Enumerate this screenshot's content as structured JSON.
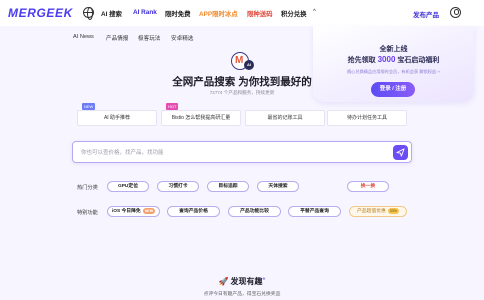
{
  "header": {
    "logo": "MERGEEK",
    "nav": [
      {
        "label": "AI 搜索",
        "color": "#222222"
      },
      {
        "label": "AI Rank",
        "color": "#3a2bd8"
      },
      {
        "label": "限时免费",
        "color": "#222222"
      },
      {
        "label": "APP限时冰点",
        "color": "#f08a2c"
      },
      {
        "label": "限种送码",
        "color": "#e0473a"
      },
      {
        "label": "积分兑换",
        "color": "#222222"
      }
    ],
    "more_icon": "chevron-up-icon",
    "publish_label": "发布产品"
  },
  "subnav": [
    "AI News",
    "产品情报",
    "极客玩法",
    "安卓精选"
  ],
  "promo": {
    "line1": "全新上线",
    "line2_prefix": "抢先领取 ",
    "line2_number": "3000",
    "line2_suffix": " 宝石启动福利",
    "line3": "随心兑换精品应用限时会员，有机会获 解锁权益 ››",
    "cta": "登录 / 注册"
  },
  "hero": {
    "mascot_letter": "M",
    "mascot_badge": "AI",
    "title": "全网产品搜索 为你找到最好的",
    "subtitle": "72774 个产品和服务，持续更新"
  },
  "top_chips": [
    {
      "label": "AI 助手推荐",
      "tag": "NEW",
      "tag_color": "#6b7cf5"
    },
    {
      "label": "Bistio 怎么帮我提高研汇量",
      "tag": "HOT",
      "tag_color": "#e64db3"
    },
    {
      "label": "最省的记账工具",
      "tag": "",
      "tag_color": ""
    },
    {
      "label": "待办计划任务工具",
      "tag": "",
      "tag_color": ""
    }
  ],
  "search": {
    "placeholder": "你也可以查价格，找产品，找功能"
  },
  "hot_categories": {
    "label": "热门分类",
    "items": [
      "GPU定位",
      "习惯打卡",
      "目标追踪",
      "天体搜索",
      "换一换"
    ]
  },
  "special_features": {
    "label": "特别功能",
    "items": [
      {
        "label": "iOS 今日降免",
        "badge": "NEW"
      },
      {
        "label": "查询产品价格",
        "badge": ""
      },
      {
        "label": "产品功能比较",
        "badge": ""
      },
      {
        "label": "平替产品查询",
        "badge": ""
      },
      {
        "label": "产品超值优惠",
        "badge": "33%"
      }
    ]
  },
  "discover": {
    "title": "发现有趣",
    "sparkle": "+",
    "subtitle": "点评今日有趣产品，得宝石兑换奖品"
  }
}
